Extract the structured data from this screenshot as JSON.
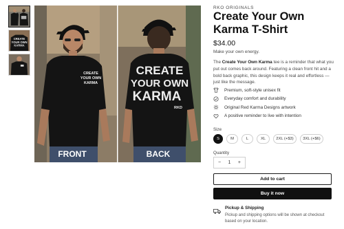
{
  "gallery": {
    "thumbnails": [
      {
        "name": "front-and-back"
      },
      {
        "name": "back-closeup"
      },
      {
        "name": "front-closeup"
      }
    ],
    "selected_index": 0,
    "front_label": "FRONT",
    "back_label": "BACK",
    "front_print": [
      "CREATE",
      "YOUR OWN",
      "KARMA"
    ],
    "back_print": [
      "CREATE",
      "YOUR OWN",
      "KARMA"
    ],
    "back_print_logo": "RKD",
    "thumb_print": [
      "CREATE",
      "YOUR OWN",
      "KARMA"
    ]
  },
  "product": {
    "brand": "RKO ORIGINALS",
    "title": "Create Your Own Karma T-Shirt",
    "price": "$34.00",
    "tagline": "Make your own energy.",
    "description_prefix": "The ",
    "description_bold": "Create Your Own Karma",
    "description_rest": " tee is a reminder that what you put out comes back around. Featuring a clean front hit and a bold back graphic, this design keeps it real and effortless — just like the message."
  },
  "features": [
    {
      "icon": "tshirt-icon",
      "label": "Premium, soft-style unisex fit"
    },
    {
      "icon": "check-circle-icon",
      "label": "Everyday comfort and durability"
    },
    {
      "icon": "sparkle-icon",
      "label": "Original Red Karma Designs artwork"
    },
    {
      "icon": "heart-icon",
      "label": "A positive reminder to live with intention"
    }
  ],
  "size": {
    "label": "Size",
    "options": [
      "S",
      "M",
      "L",
      "XL",
      "2XL (+$3)",
      "3XL (+$6)"
    ],
    "selected": "S"
  },
  "quantity": {
    "label": "Quantity",
    "value": "1",
    "minus": "−",
    "plus": "+"
  },
  "actions": {
    "add_to_cart": "Add to cart",
    "buy_now": "Buy it now"
  },
  "shipping": {
    "icon": "truck-icon",
    "title": "Pickup & Shipping",
    "text": "Pickup and shipping options will be shown at checkout based on your location."
  },
  "colors": {
    "accent": "#111111",
    "shirt": "#141414",
    "print": "#f2f2f2",
    "background": "#ffffff"
  }
}
